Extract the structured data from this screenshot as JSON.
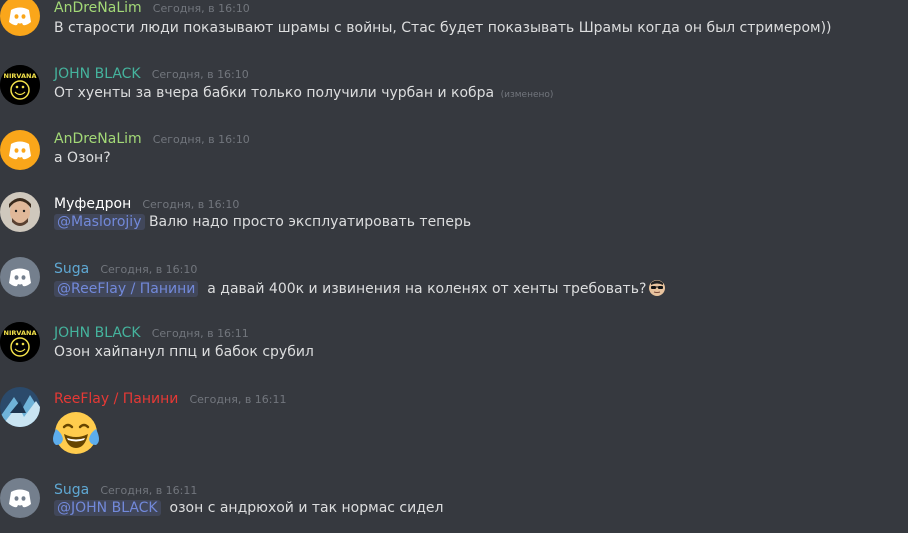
{
  "colors": {
    "background": "#36393f",
    "text": "#dcddde",
    "timestamp": "#72767d",
    "mention": "#7289da",
    "discord_orange": "#faa61a",
    "discord_gray": "#747f8d",
    "author_green": "#a3d977",
    "author_teal": "#45b39d",
    "author_white": "#ffffff",
    "author_blue": "#5fa8d3",
    "author_red": "#e53935"
  },
  "messages": [
    {
      "author": "AnDreNaLim",
      "author_color": "#a3d977",
      "avatar_icon": "discord-logo-orange",
      "timestamp": "Сегодня, в 16:10",
      "text": "В старости люди показывают шрамы с войны, Стас будет показывать Шрамы когда он был стримером))"
    },
    {
      "author": "JOHN BLACK",
      "author_color": "#45b39d",
      "avatar_icon": "nirvana-smiley",
      "avatar_text": "NIRVANA",
      "timestamp": "Сегодня, в 16:10",
      "text": "От хуенты за вчера бабки только получили чурбан и кобра",
      "edited": "(изменено)"
    },
    {
      "author": "AnDreNaLim",
      "author_color": "#a3d977",
      "avatar_icon": "discord-logo-orange",
      "timestamp": "Сегодня, в 16:10",
      "text": "а Озон?"
    },
    {
      "author": "Муфедрон",
      "author_color": "#ffffff",
      "avatar_icon": "photo-face",
      "timestamp": "Сегодня, в 16:10",
      "mention": "@Maslorojiy",
      "text": "Валю надо просто эксплуатировать теперь"
    },
    {
      "author": "Suga",
      "author_color": "#5fa8d3",
      "avatar_icon": "discord-logo-gray",
      "timestamp": "Сегодня, в 16:10",
      "mention": "@ReeFlay / Панини",
      "text": "а давай 400к и извинения на коленях от хенты требовать?",
      "trailing_emoji": "sunglasses-face-emoji"
    },
    {
      "author": "JOHN BLACK",
      "author_color": "#45b39d",
      "avatar_icon": "nirvana-smiley",
      "avatar_text": "NIRVANA",
      "timestamp": "Сегодня, в 16:11",
      "text": "Озон хайпанул ппц и бабок срубил"
    },
    {
      "author": "ReeFlay / Панини",
      "author_color": "#e53935",
      "avatar_icon": "anime-avatar",
      "timestamp": "Сегодня, в 16:11",
      "jumbo_emoji": "tears-of-joy-emoji"
    },
    {
      "author": "Suga",
      "author_color": "#5fa8d3",
      "avatar_icon": "discord-logo-gray",
      "timestamp": "Сегодня, в 16:11",
      "mention": "@JOHN BLACK",
      "text": "озон с андрюхой и так нормас сидел"
    }
  ]
}
